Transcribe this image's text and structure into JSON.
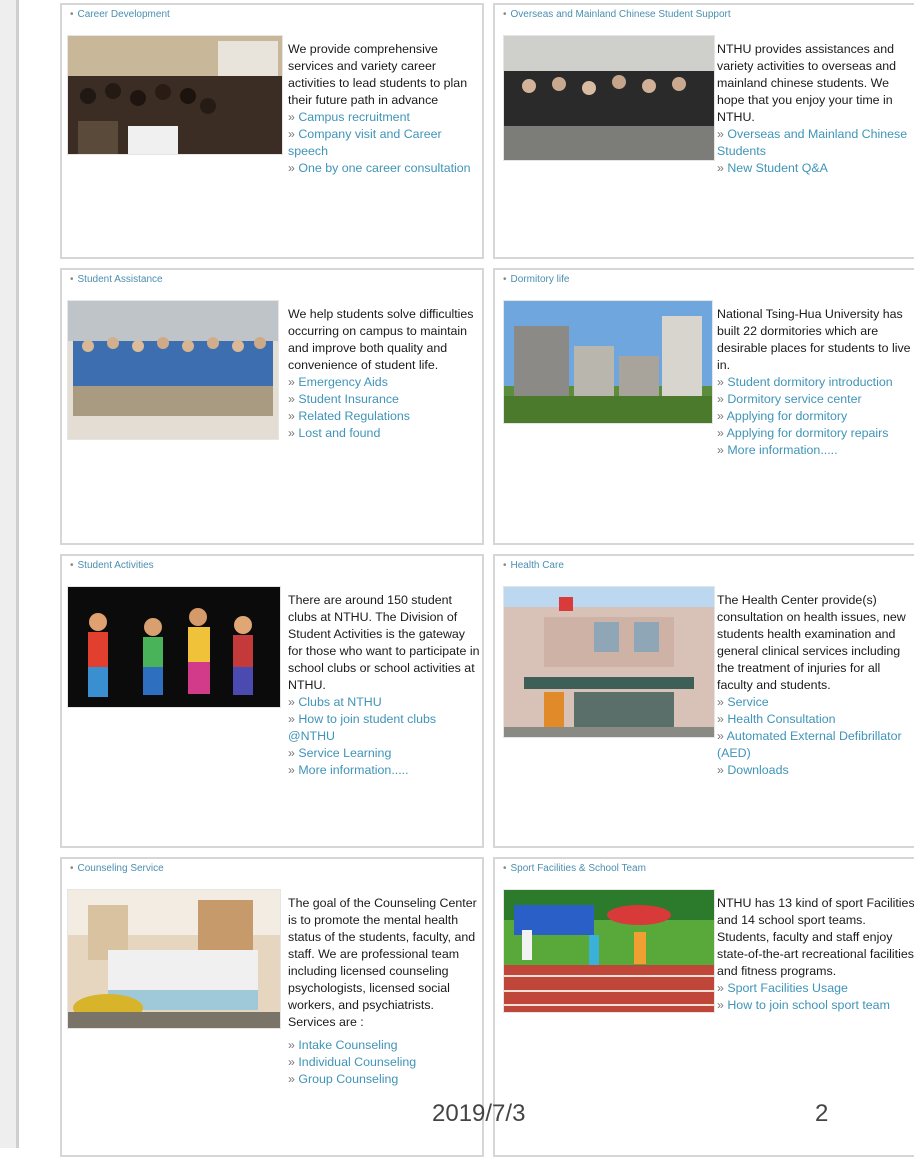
{
  "cards": [
    {
      "title": "Career Development",
      "text": "We provide comprehensive services and variety career activities to lead students to plan their future path in advance",
      "links": [
        "Campus recruitment",
        "Company visit and Career speech",
        "One by one career consultation"
      ]
    },
    {
      "title": "Overseas and Mainland Chinese Student Support",
      "text": "NTHU provides assistances and variety activities to overseas and mainland chinese students. We hope that you enjoy your time in NTHU.",
      "links": [
        "Overseas and Mainland Chinese Students",
        "New Student Q&A"
      ]
    },
    {
      "title": "Student Assistance",
      "text": "We help students solve difficulties occurring on campus to maintain and improve both quality and convenience of student life.",
      "links": [
        "Emergency Aids",
        "Student Insurance",
        "Related Regulations",
        "Lost and found"
      ]
    },
    {
      "title": "Dormitory life",
      "text": "National Tsing-Hua University has built 22 dormitories which are desirable places for students to live in.",
      "links": [
        "Student dormitory introduction",
        "Dormitory service center",
        "Applying for dormitory",
        "Applying for dormitory repairs",
        "More information....."
      ]
    },
    {
      "title": "Student Activities",
      "text": "There are around 150 student clubs at NTHU. The Division of Student Activities is the gateway for those who want to participate in school clubs or school activities at NTHU.",
      "links": [
        "Clubs at NTHU",
        "How to join student clubs @NTHU",
        "Service Learning",
        "More information....."
      ]
    },
    {
      "title": "Health Care",
      "text": "The Health Center provide(s) consultation on health issues, new students health examination and general clinical services including the treatment of injuries for all faculty and students.",
      "links": [
        "Service",
        "Health Consultation",
        "Automated External Defibrillator (AED)",
        "Downloads"
      ]
    },
    {
      "title": "Counseling Service",
      "text": "The goal of the Counseling Center is to promote the mental health status of the students, faculty, and staff. We are professional team including licensed counseling psychologists, licensed social workers, and psychiatrists. Services are :",
      "links": [
        "Intake Counseling",
        "Individual Counseling",
        "Group Counseling"
      ]
    },
    {
      "title": "Sport Facilities & School Team",
      "text": "NTHU has 13 kind of sport Facilities and 14 school sport teams. Students, faculty and staff enjoy state-of-the-art recreational facilities and fitness programs.",
      "links": [
        "Sport Facilities Usage",
        "How to join school sport team"
      ]
    }
  ],
  "link_bullet": "»",
  "title_bullet": "•",
  "footer": {
    "date": "2019/7/3",
    "page": "2"
  },
  "colors": {
    "link": "#3f94b8",
    "title": "#4a8fb0",
    "border": "#d6d6d6"
  }
}
